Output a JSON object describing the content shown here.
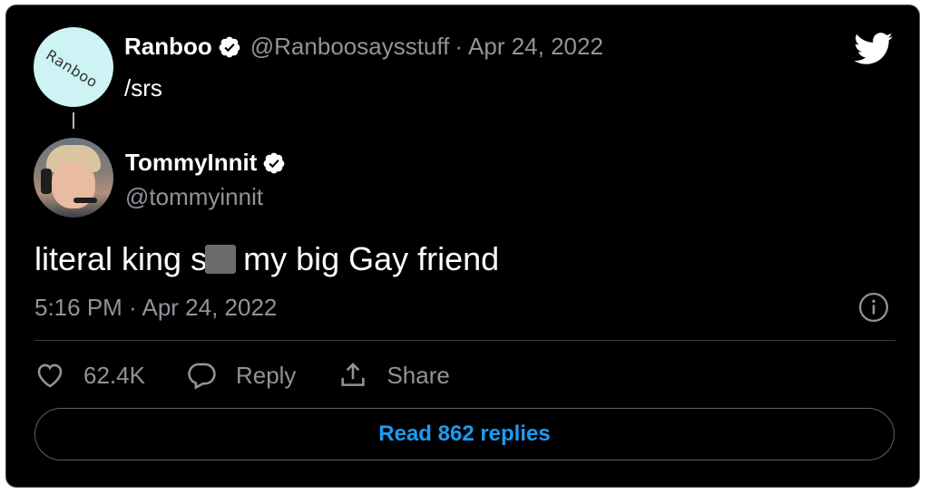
{
  "parent_tweet": {
    "author_name": "Ranboo",
    "author_handle": "@Ranboosaysstuff",
    "separator": "·",
    "date": "Apr 24, 2022",
    "text": "/srs",
    "avatar_text": "Ranboo",
    "avatar_color": "#cdf3f5",
    "verified_icon": "verified-badge-icon"
  },
  "main_tweet": {
    "author_name": "TommyInnit",
    "author_handle": "@tommyinnit",
    "text_before": "literal king sl",
    "text_after": " my big Gay friend",
    "timestamp": "5:16 PM · Apr 24, 2022",
    "verified_icon": "verified-badge-icon"
  },
  "actions": {
    "like_count": "62.4K",
    "reply_label": "Reply",
    "share_label": "Share"
  },
  "read_replies_label": "Read 862 replies",
  "colors": {
    "background": "#000000",
    "accent": "#1d9bf0",
    "muted_text": "#8f9499",
    "border": "#536471"
  }
}
